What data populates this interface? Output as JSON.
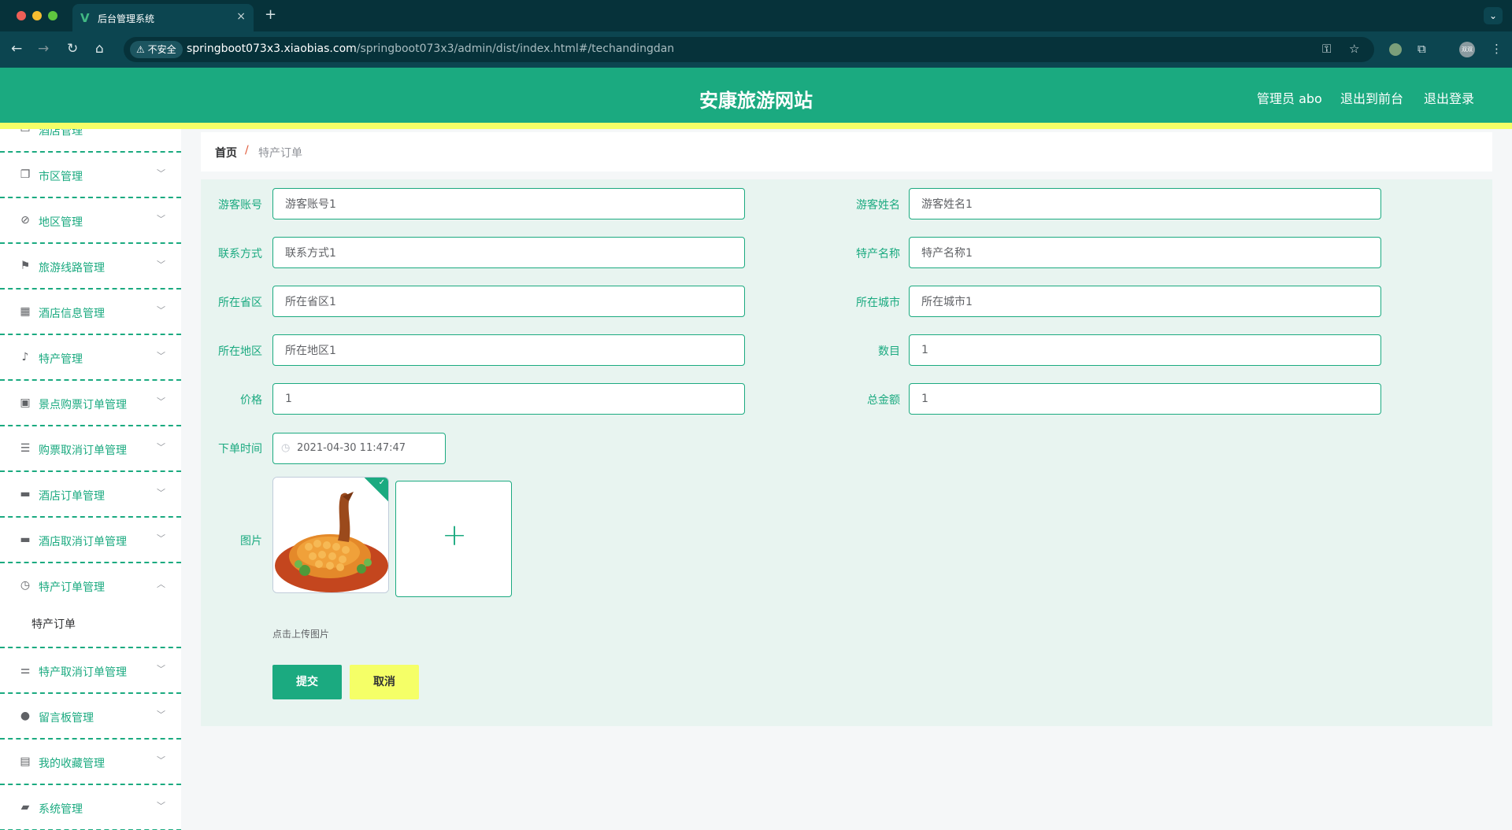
{
  "browser": {
    "tab_title": "后台管理系统",
    "tab_logo": "V",
    "close_glyph": "×",
    "new_tab_glyph": "+",
    "insecure_label": "不安全",
    "url_host": "springboot073x3.xiaobias.com",
    "url_path": "/springboot073x3/admin/dist/index.html#/techandingdan",
    "profile_text": "双双"
  },
  "header": {
    "site_title": "安康旅游网站",
    "admin_label": "管理员 abo",
    "front_link": "退出到前台",
    "logout_link": "退出登录",
    "brand_color": "#1baa80",
    "strip_color": "#f5ff67"
  },
  "sidebar": {
    "items": [
      {
        "label": "酒店管理",
        "icon": "partial-icon"
      },
      {
        "label": "市区管理",
        "icon": "copy-icon"
      },
      {
        "label": "地区管理",
        "icon": "bell-off-icon"
      },
      {
        "label": "旅游线路管理",
        "icon": "flag-icon"
      },
      {
        "label": "酒店信息管理",
        "icon": "grid-icon"
      },
      {
        "label": "特产管理",
        "icon": "microphone-icon"
      },
      {
        "label": "景点购票订单管理",
        "icon": "clipboard-icon"
      },
      {
        "label": "购票取消订单管理",
        "icon": "list-icon"
      },
      {
        "label": "酒店订单管理",
        "icon": "monitor-icon"
      },
      {
        "label": "酒店取消订单管理",
        "icon": "printer-icon"
      },
      {
        "label": "特产订单管理",
        "icon": "clock-icon",
        "expanded": true
      },
      {
        "label": "特产取消订单管理",
        "icon": "sliders-icon"
      },
      {
        "label": "留言板管理",
        "icon": "balloon-icon"
      },
      {
        "label": "我的收藏管理",
        "icon": "document-icon"
      },
      {
        "label": "系统管理",
        "icon": "ticket-icon"
      }
    ],
    "submenu_label": "特产订单"
  },
  "breadcrumb": {
    "home": "首页",
    "separator": "/",
    "current": "特产订单"
  },
  "form": {
    "fields": {
      "youkezhanghao": {
        "label": "游客账号",
        "value": "游客账号1"
      },
      "youkexingming": {
        "label": "游客姓名",
        "value": "游客姓名1"
      },
      "lianxifangshi": {
        "label": "联系方式",
        "value": "联系方式1"
      },
      "techanmingcheng": {
        "label": "特产名称",
        "value": "特产名称1"
      },
      "suozaishengqu": {
        "label": "所在省区",
        "value": "所在省区1"
      },
      "suozaichengshi": {
        "label": "所在城市",
        "value": "所在城市1"
      },
      "suozaidiqu": {
        "label": "所在地区",
        "value": "所在地区1"
      },
      "shumu": {
        "label": "数目",
        "value": "1"
      },
      "jiage": {
        "label": "价格",
        "value": "1"
      },
      "zongjine": {
        "label": "总金额",
        "value": "1"
      },
      "xiadanshijian": {
        "label": "下单时间",
        "value": "2021-04-30 11:47:47"
      },
      "tupian": {
        "label": "图片"
      }
    },
    "upload_tip": "点击上传图片",
    "upload_plus": "+",
    "submit_label": "提交",
    "cancel_label": "取消"
  }
}
